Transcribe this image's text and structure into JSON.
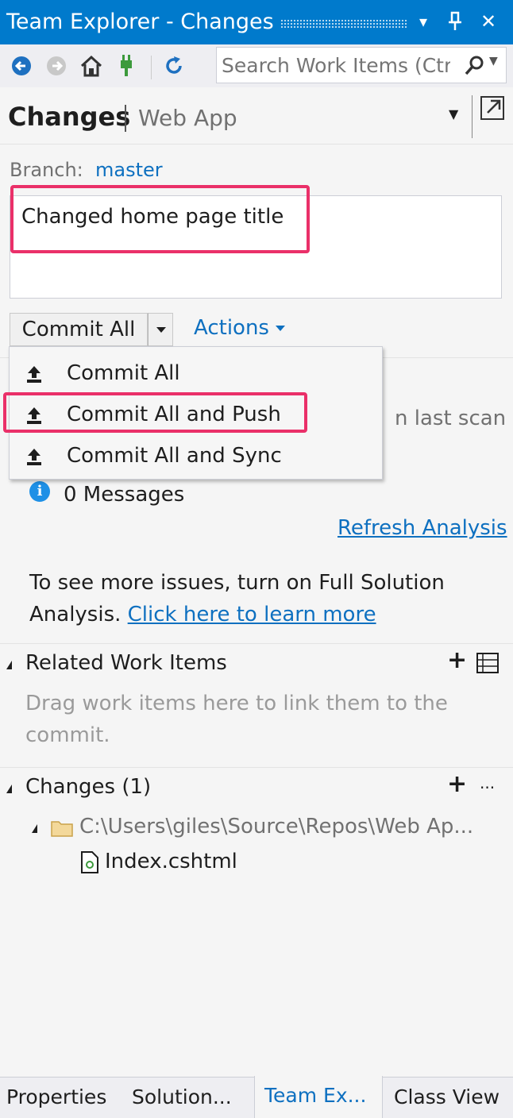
{
  "window": {
    "title": "Team Explorer - Changes",
    "dropdown_glyph": "▾",
    "pin_glyph": "⊥",
    "close_glyph": "✕"
  },
  "toolbar": {
    "search_placeholder": "Search Work Items (Ctrl+')",
    "icons": [
      "back-icon",
      "forward-icon",
      "home-icon",
      "connect-icon",
      "refresh-icon",
      "search-icon"
    ]
  },
  "header": {
    "title": "Changes",
    "subtitle": "Web App"
  },
  "branch": {
    "label": "Branch:",
    "name": "master"
  },
  "commit_message": "Changed home page title",
  "commit": {
    "button_label": "Commit All",
    "actions_label": "Actions",
    "menu": [
      {
        "label": "Commit All",
        "icon": "commit-upload-icon"
      },
      {
        "label": "Commit All and Push",
        "icon": "commit-upload-icon"
      },
      {
        "label": "Commit All and Sync",
        "icon": "commit-upload-icon"
      }
    ]
  },
  "analysis": {
    "partial_text": "n last scan",
    "messages": "0 Messages",
    "refresh_link": "Refresh Analysis",
    "more_text": "To see more issues, turn on Full Solution Analysis.",
    "more_link": "Click here to learn more"
  },
  "related_work_items": {
    "title": "Related Work Items",
    "hint": "Drag work items here to link them to the commit."
  },
  "changes": {
    "title": "Changes (1)",
    "more_glyph": "···",
    "folder_path": "C:\\Users\\giles\\Source\\Repos\\Web Ap...",
    "file": "Index.cshtml"
  },
  "tabs": [
    {
      "label": "Properties"
    },
    {
      "label": "Solution..."
    },
    {
      "label": "Team Ex..."
    },
    {
      "label": "Class View"
    }
  ],
  "colors": {
    "accent": "#007acc",
    "link": "#0e70c0",
    "highlight": "#ea3069"
  }
}
